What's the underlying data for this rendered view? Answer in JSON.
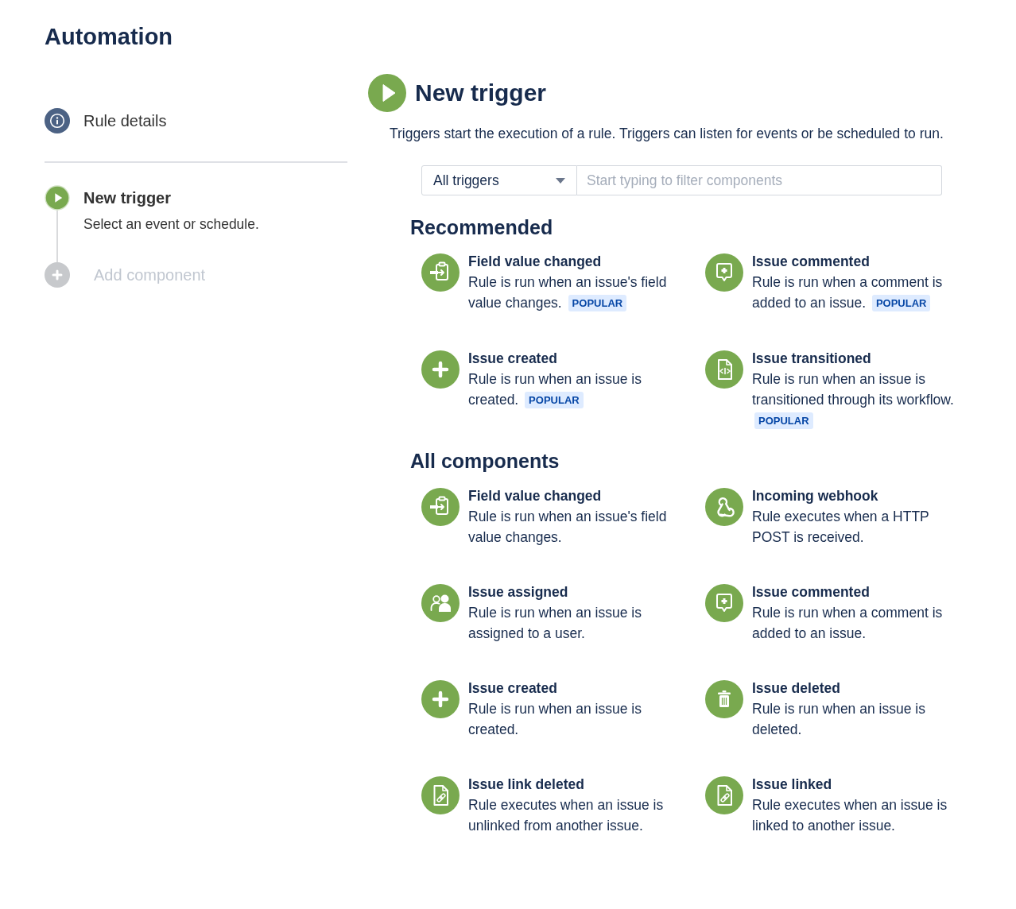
{
  "page": {
    "title": "Automation"
  },
  "sidebar": {
    "details": {
      "label": "Rule details"
    },
    "steps": [
      {
        "kind": "trigger",
        "label": "New trigger",
        "description": "Select an event or schedule.",
        "selected": true,
        "disabled": false
      },
      {
        "kind": "add",
        "label": "Add component",
        "selected": false,
        "disabled": true
      }
    ]
  },
  "header": {
    "title": "New trigger",
    "description": "Triggers start the execution of a rule. Triggers can listen for events or be scheduled to run."
  },
  "filter": {
    "dropdown": {
      "value": "All triggers"
    },
    "search": {
      "placeholder": "Start typing to filter components"
    }
  },
  "sections": [
    {
      "heading": "Recommended",
      "items": [
        {
          "kind": "field",
          "title": "Field value changed",
          "description": "Rule is run when an issue's field value changes.",
          "badge": "POPULAR"
        },
        {
          "kind": "comment",
          "title": "Issue commented",
          "description": "Rule is run when a comment is added to an issue.",
          "badge": "POPULAR"
        },
        {
          "kind": "create",
          "title": "Issue created",
          "description": "Rule is run when an issue is created.",
          "badge": "POPULAR"
        },
        {
          "kind": "transition",
          "title": "Issue transitioned",
          "description": "Rule is run when an issue is transitioned through its workflow.",
          "badge": "POPULAR"
        }
      ]
    },
    {
      "heading": "All components",
      "items": [
        {
          "kind": "field",
          "title": "Field value changed",
          "description": "Rule is run when an issue's field value changes."
        },
        {
          "kind": "webhook",
          "title": "Incoming webhook",
          "description": "Rule executes when a HTTP POST is received."
        },
        {
          "kind": "assign",
          "title": "Issue assigned",
          "description": "Rule is run when an issue is assigned to a user."
        },
        {
          "kind": "comment",
          "title": "Issue commented",
          "description": "Rule is run when a comment is added to an issue."
        },
        {
          "kind": "create",
          "title": "Issue created",
          "description": "Rule is run when an issue is created."
        },
        {
          "kind": "delete",
          "title": "Issue deleted",
          "description": "Rule is run when an issue is deleted."
        },
        {
          "kind": "link",
          "title": "Issue link deleted",
          "description": "Rule executes when an issue is unlinked from another issue."
        },
        {
          "kind": "link",
          "title": "Issue linked",
          "description": "Rule executes when an issue is linked to another issue."
        }
      ]
    }
  ]
}
